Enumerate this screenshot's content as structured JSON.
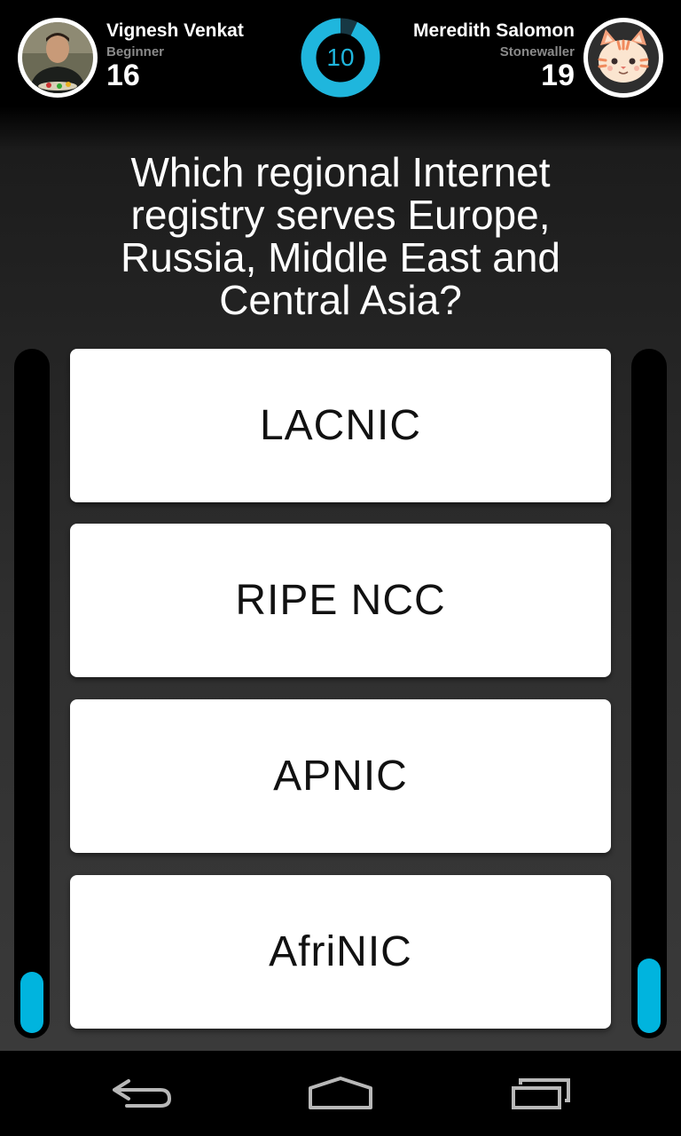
{
  "player1": {
    "name": "Vignesh Venkat",
    "rank": "Beginner",
    "score": "16",
    "progress": 0.09
  },
  "player2": {
    "name": "Meredith Salomon",
    "rank": "Stonewaller",
    "score": "19",
    "progress": 0.11
  },
  "timer": {
    "seconds_left": "10",
    "fraction_remaining": 0.93,
    "color": "#1fb6dd"
  },
  "question": {
    "text": "Which regional Internet registry serves Europe, Russia, Middle East and Central Asia?"
  },
  "answers": [
    {
      "label": "LACNIC"
    },
    {
      "label": "RIPE NCC"
    },
    {
      "label": "APNIC"
    },
    {
      "label": "AfriNIC"
    }
  ],
  "navbar": {
    "icons": [
      "back-icon",
      "home-icon",
      "recent-apps-icon"
    ]
  },
  "colors": {
    "accent": "#00b4de"
  }
}
